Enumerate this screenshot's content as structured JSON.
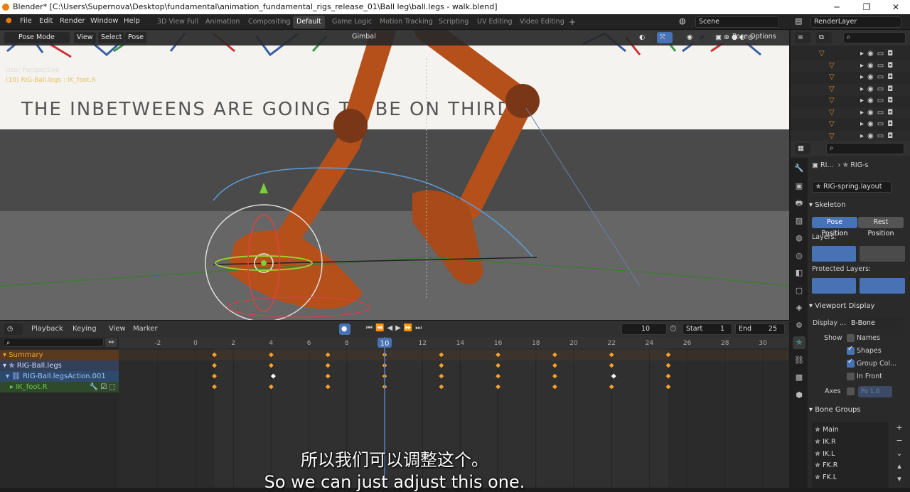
{
  "window": {
    "title": "Blender* [C:\\Users\\Supernova\\Desktop\\fundamental\\animation_fundamental_rigs_release_01\\Ball leg\\ball.legs - walk.blend]",
    "min": "─",
    "max": "❐",
    "close": "✕"
  },
  "menu": [
    "File",
    "Edit",
    "Render",
    "Window",
    "Help"
  ],
  "workspaces": [
    "3D View Full",
    "Animation",
    "Compositing",
    "Default",
    "Game Logic",
    "Motion Tracking",
    "Scripting",
    "UV Editing",
    "Video Editing"
  ],
  "active_workspace": "Default",
  "add_tab": "+",
  "scene": "Scene",
  "render_layer": "RenderLayer",
  "viewport": {
    "orientation": "Gimbal",
    "pose_options": "Pose Options",
    "mode": "Pose Mode",
    "menus": [
      "View",
      "Select",
      "Pose"
    ],
    "perspective": "User Perspective",
    "active_info": "(10) RIG-Ball.legs : IK_foot.R",
    "whiteboard_text": "THE INBETWEENS ARE GOING TO BE ON THIRDS"
  },
  "timeline": {
    "menus": [
      "Playback",
      "Keying",
      "View",
      "Marker"
    ],
    "current_frame": "10",
    "start_label": "Start",
    "start": "1",
    "end_label": "End",
    "end": "25",
    "ruler": [
      "-2",
      "0",
      "2",
      "4",
      "6",
      "8",
      "10",
      "12",
      "14",
      "16",
      "18",
      "20",
      "22",
      "24",
      "26",
      "28",
      "30"
    ],
    "playhead": "10"
  },
  "channels": [
    {
      "name": "Summary",
      "color": "#f0a030"
    },
    {
      "name": "RIG-Ball.legs",
      "color": "#cfd8ff"
    },
    {
      "name": "RIG-Ball.legsAction.001",
      "color": "#9fc0ff"
    },
    {
      "name": "IK_foot.R",
      "color": "#66cc44"
    }
  ],
  "keyframes": {
    "frames": [
      1,
      4,
      7,
      10,
      13,
      16,
      19,
      22,
      25
    ],
    "selected": [
      [
        2,
        4
      ],
      [
        2,
        22
      ]
    ]
  },
  "properties": {
    "breadcrumb1": "RI...",
    "breadcrumb2": "RIG-s",
    "datablock": "RIG-spring.layout",
    "skeleton": "Skeleton",
    "pose_position": "Pose Position",
    "rest_position": "Rest Position",
    "layers": "Layers:",
    "protected_layers": "Protected Layers:",
    "viewport_display": "Viewport Display",
    "display_as_label": "Display ...",
    "display_as": "B-Bone",
    "show": "Show",
    "names": "Names",
    "shapes": "Shapes",
    "group_colors": "Group Col...",
    "in_front": "In Front",
    "axes": "Axes",
    "axes_value": "Po 1.0",
    "bone_groups": "Bone Groups",
    "groups": [
      "Main",
      "IK.R",
      "IK.L",
      "FK.R",
      "FK.L"
    ]
  },
  "subtitle": {
    "zh": "所以我们可以调整这个。",
    "en": "So we can just adjust this one."
  },
  "icons": {
    "search": "⌕",
    "eye": "👁",
    "cursor": "▸",
    "camera": "▣"
  }
}
